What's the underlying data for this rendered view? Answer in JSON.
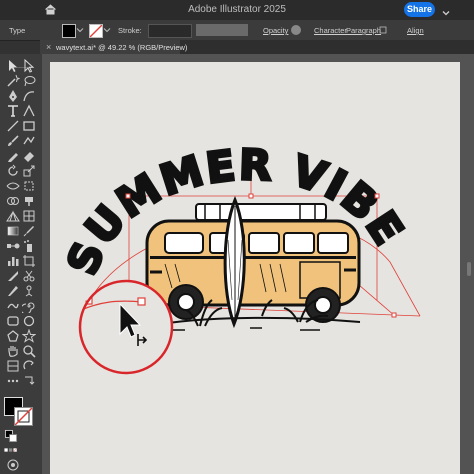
{
  "window": {
    "app_title": "Adobe Illustrator 2025",
    "share_label": "Share"
  },
  "control_bar": {
    "type_label": "Type",
    "stroke_label": "Stroke:",
    "opacity_label": "Opacity",
    "character_label": "Character",
    "paragraph_label": "Paragraph",
    "align_label": "Align"
  },
  "document_tab": {
    "title": "wavytext.ai* @ 49.22 % (RGB/Preview)",
    "close_glyph": "×"
  },
  "artwork": {
    "text": "SUMMER VIBES",
    "visible_letters": [
      "U",
      "M",
      "M",
      "E",
      "R",
      "V",
      "I",
      "B",
      "E",
      "S"
    ]
  },
  "colors": {
    "accent": "#1473e6",
    "selection": "#e0403a",
    "magnifier": "#d9262b",
    "artboard": "#e5e4e0",
    "van_yellow": "#f0c27b"
  },
  "icons": [
    "home-icon",
    "chevron-down-icon",
    "selection-tool-icon",
    "direct-selection-tool-icon",
    "pen-tool-icon",
    "type-tool-icon",
    "rectangle-tool-icon",
    "paintbrush-tool-icon",
    "eraser-tool-icon",
    "rotate-tool-icon",
    "scale-tool-icon",
    "gradient-tool-icon",
    "eyedropper-tool-icon",
    "hand-tool-icon",
    "zoom-tool-icon",
    "arrow-cursor-icon"
  ]
}
